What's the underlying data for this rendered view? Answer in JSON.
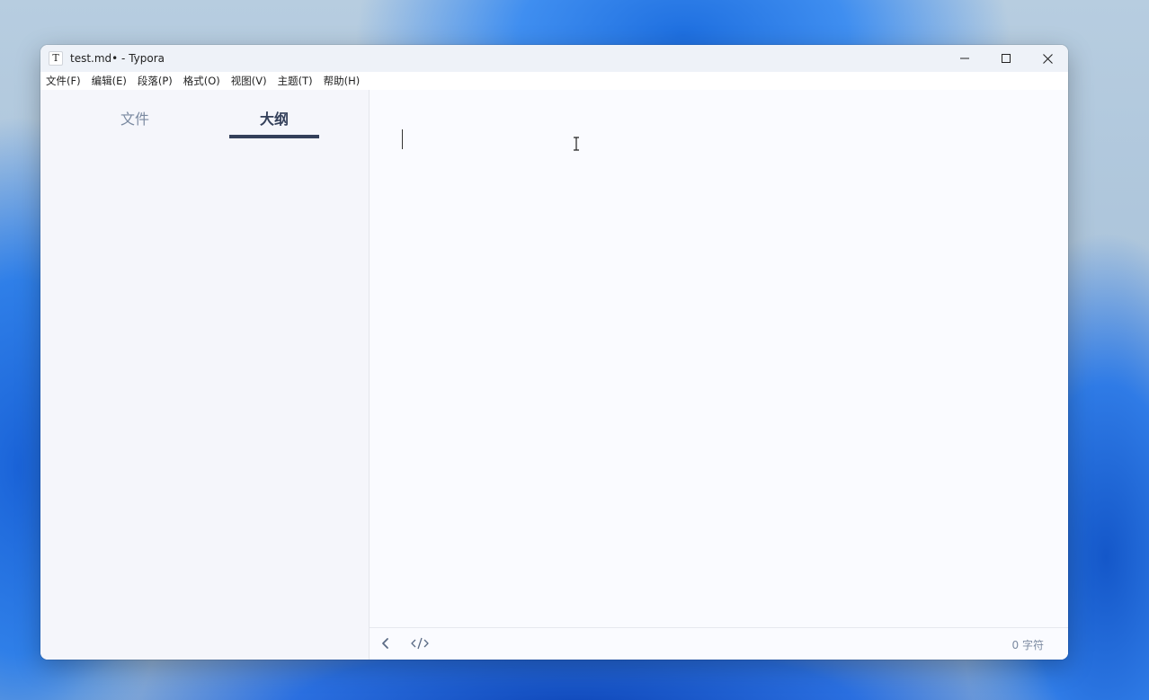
{
  "window": {
    "title": "test.md• - Typora",
    "app_icon_letter": "T",
    "controls": [
      "minimize-icon",
      "maximize-icon",
      "close-icon"
    ]
  },
  "menubar": {
    "items": [
      "文件(F)",
      "编辑(E)",
      "段落(P)",
      "格式(O)",
      "视图(V)",
      "主题(T)",
      "帮助(H)"
    ]
  },
  "sidebar": {
    "tabs": [
      {
        "label": "文件",
        "active": false
      },
      {
        "label": "大纲",
        "active": true
      }
    ]
  },
  "editor": {
    "content": ""
  },
  "statusbar": {
    "toggle_sidebar_icon": "chevron-left-icon",
    "source_mode_icon": "code-icon",
    "word_count": "0 字符"
  },
  "colors": {
    "active_tab": "#34405a",
    "inactive_tab": "#7b8aa1",
    "editor_bg": "#fafbff"
  }
}
